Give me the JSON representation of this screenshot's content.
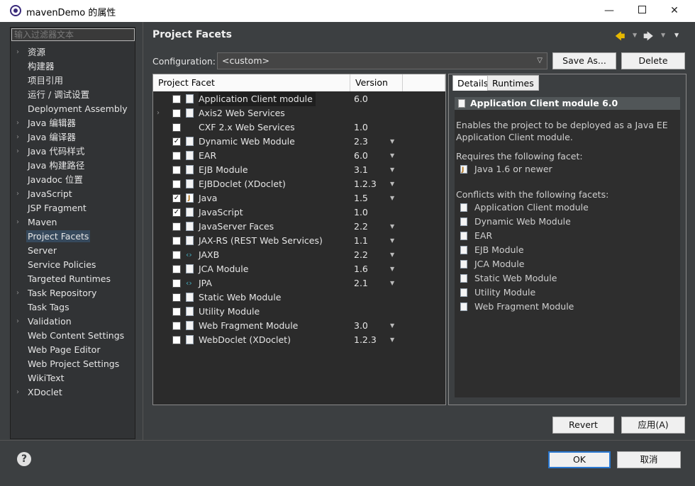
{
  "window": {
    "title": "mavenDemo 的属性",
    "minimize": "—",
    "close": "✕"
  },
  "filter": {
    "placeholder": "输入过滤器文本"
  },
  "sidebar": {
    "items": [
      {
        "label": "资源",
        "expandable": true
      },
      {
        "label": "构建器",
        "expandable": false
      },
      {
        "label": "项目引用",
        "expandable": false
      },
      {
        "label": "运行 / 调试设置",
        "expandable": false
      },
      {
        "label": "Deployment Assembly",
        "expandable": false
      },
      {
        "label": "Java 编辑器",
        "expandable": true
      },
      {
        "label": "Java 编译器",
        "expandable": true
      },
      {
        "label": "Java 代码样式",
        "expandable": true
      },
      {
        "label": "Java 构建路径",
        "expandable": false
      },
      {
        "label": "Javadoc 位置",
        "expandable": false
      },
      {
        "label": "JavaScript",
        "expandable": true
      },
      {
        "label": "JSP Fragment",
        "expandable": false
      },
      {
        "label": "Maven",
        "expandable": true
      },
      {
        "label": "Project Facets",
        "expandable": false,
        "selected": true
      },
      {
        "label": "Server",
        "expandable": false
      },
      {
        "label": "Service Policies",
        "expandable": false
      },
      {
        "label": "Targeted Runtimes",
        "expandable": false
      },
      {
        "label": "Task Repository",
        "expandable": true
      },
      {
        "label": "Task Tags",
        "expandable": false
      },
      {
        "label": "Validation",
        "expandable": true
      },
      {
        "label": "Web Content Settings",
        "expandable": false
      },
      {
        "label": "Web Page Editor",
        "expandable": false
      },
      {
        "label": "Web Project Settings",
        "expandable": false
      },
      {
        "label": "WikiText",
        "expandable": false
      },
      {
        "label": "XDoclet",
        "expandable": true
      }
    ]
  },
  "page": {
    "title": "Project Facets",
    "back_icon": "🡄",
    "forward_icon": "🡆",
    "dropdown": "▼"
  },
  "configuration": {
    "label": "Configuration:",
    "value": "<custom>",
    "save_as": "Save As...",
    "delete": "Delete"
  },
  "facets": {
    "col_facet": "Project Facet",
    "col_version": "Version",
    "rows": [
      {
        "name": "Application Client module",
        "version": "6.0",
        "checked": false,
        "expandable": false,
        "dropdown": false,
        "icon": "page",
        "highlight": true
      },
      {
        "name": "Axis2 Web Services",
        "version": "",
        "checked": false,
        "expandable": true,
        "dropdown": false,
        "icon": "page"
      },
      {
        "name": "CXF 2.x Web Services",
        "version": "1.0",
        "checked": false,
        "expandable": false,
        "dropdown": false,
        "icon": "none"
      },
      {
        "name": "Dynamic Web Module",
        "version": "2.3",
        "checked": true,
        "expandable": false,
        "dropdown": true,
        "icon": "page"
      },
      {
        "name": "EAR",
        "version": "6.0",
        "checked": false,
        "expandable": false,
        "dropdown": true,
        "icon": "page"
      },
      {
        "name": "EJB Module",
        "version": "3.1",
        "checked": false,
        "expandable": false,
        "dropdown": true,
        "icon": "page"
      },
      {
        "name": "EJBDoclet (XDoclet)",
        "version": "1.2.3",
        "checked": false,
        "expandable": false,
        "dropdown": true,
        "icon": "page"
      },
      {
        "name": "Java",
        "version": "1.5",
        "checked": true,
        "expandable": false,
        "dropdown": true,
        "icon": "java"
      },
      {
        "name": "JavaScript",
        "version": "1.0",
        "checked": true,
        "expandable": false,
        "dropdown": false,
        "icon": "page"
      },
      {
        "name": "JavaServer Faces",
        "version": "2.2",
        "checked": false,
        "expandable": false,
        "dropdown": true,
        "icon": "page"
      },
      {
        "name": "JAX-RS (REST Web Services)",
        "version": "1.1",
        "checked": false,
        "expandable": false,
        "dropdown": true,
        "icon": "page"
      },
      {
        "name": "JAXB",
        "version": "2.2",
        "checked": false,
        "expandable": false,
        "dropdown": true,
        "icon": "xml"
      },
      {
        "name": "JCA Module",
        "version": "1.6",
        "checked": false,
        "expandable": false,
        "dropdown": true,
        "icon": "page"
      },
      {
        "name": "JPA",
        "version": "2.1",
        "checked": false,
        "expandable": false,
        "dropdown": true,
        "icon": "xml"
      },
      {
        "name": "Static Web Module",
        "version": "",
        "checked": false,
        "expandable": false,
        "dropdown": false,
        "icon": "page"
      },
      {
        "name": "Utility Module",
        "version": "",
        "checked": false,
        "expandable": false,
        "dropdown": false,
        "icon": "page"
      },
      {
        "name": "Web Fragment Module",
        "version": "3.0",
        "checked": false,
        "expandable": false,
        "dropdown": true,
        "icon": "page"
      },
      {
        "name": "WebDoclet (XDoclet)",
        "version": "1.2.3",
        "checked": false,
        "expandable": false,
        "dropdown": true,
        "icon": "page"
      }
    ]
  },
  "details": {
    "tab_details": "Details",
    "tab_runtimes": "Runtimes",
    "heading": "Application Client module 6.0",
    "desc_line1": "Enables the project to be deployed as a Java EE",
    "desc_line2": "Application Client module.",
    "requires_label": "Requires the following facet:",
    "requires": [
      {
        "label": "Java 1.6 or newer",
        "icon": "java"
      }
    ],
    "conflicts_label": "Conflicts with the following facets:",
    "conflicts": [
      "Application Client module",
      "Dynamic Web Module",
      "EAR",
      "EJB Module",
      "JCA Module",
      "Static Web Module",
      "Utility Module",
      "Web Fragment Module"
    ]
  },
  "buttons": {
    "revert": "Revert",
    "apply": "应用(A)",
    "ok": "OK",
    "cancel": "取消",
    "help": "?"
  }
}
